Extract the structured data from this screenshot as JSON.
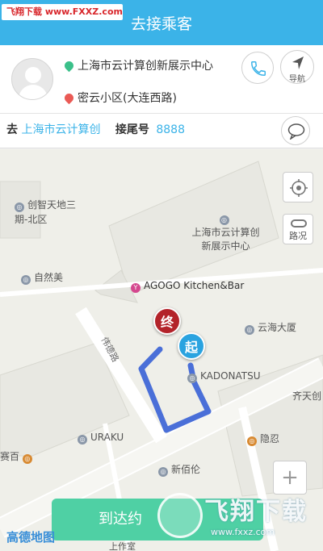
{
  "watermark_top": "飞翔下载 www.FXXZ.com",
  "titlebar": {
    "title": "去接乘客"
  },
  "passenger": {
    "from_address": "上海市云计算创新展示中心",
    "to_address": "密云小区(大连西路)",
    "nav_label": "导航"
  },
  "destination_row": {
    "dest_key": "去",
    "dest_value": "上海市云计算创",
    "tail_key": "接尾号",
    "tail_value": "8888"
  },
  "map": {
    "traffic_label": "路况",
    "zoom_in_label": "+",
    "pois": {
      "chuangzhi": "创智天地三期-北区",
      "ziranmei": "自然美",
      "cloud_center": "上海市云计算创新展示中心",
      "agogo": "AGOGO Kitchen&Bar",
      "yunhai": "云海大厦",
      "kadonatsu": "KADONATSU",
      "qitian": "齐天创",
      "uraku": "URAKU",
      "yinren": "隐忍",
      "xinbailun": "新佰伦",
      "saiyi": "赛百",
      "bottom_peek": "上作室"
    },
    "roads": {
      "road1": "伟德路"
    },
    "marker_end": "终",
    "marker_start": "起",
    "arrive_button": "到达约",
    "amap_logo": "高德地图"
  },
  "watermark_bottom": {
    "big": "飞翔下载",
    "url": "www.fxxz.com"
  },
  "colors": {
    "primary": "#3bb3e8",
    "arrive": "#4fd0a4",
    "route": "#4a6fd8",
    "end_marker": "#b3232a",
    "start_marker": "#2aa3e0"
  }
}
